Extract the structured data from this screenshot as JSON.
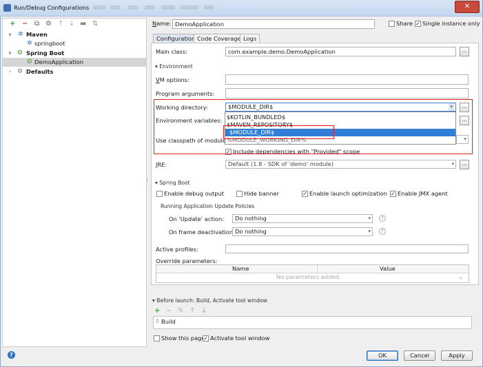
{
  "window": {
    "title": "Run/Debug Configurations"
  },
  "left_toolbar": {
    "add": "+",
    "remove": "−"
  },
  "tree": {
    "maven": "Maven",
    "springboot_item": "springboot",
    "spring_boot": "Spring Boot",
    "demo_application": "DemoApplication",
    "defaults": "Defaults"
  },
  "header": {
    "name_label": "Name:",
    "name_value": "DemoApplication",
    "share_label": "Share",
    "single_instance_label": "Single instance only"
  },
  "tabs": [
    "Configuration",
    "Code Coverage",
    "Logs"
  ],
  "config": {
    "main_class_label": "Main class:",
    "main_class_value": "com.example.demo.DemoApplication",
    "environment_header": "Environment",
    "vm_options_label": "VM options:",
    "program_args_label": "Program arguments:",
    "working_dir_label": "Working directory:",
    "working_dir_value": "$MODULE_DIR$",
    "env_vars_label": "Environment variables:",
    "classpath_label": "Use classpath of module:",
    "include_deps_label": "Include dependencies with \"Provided\" scope",
    "jre_label": "JRE:",
    "jre_value": "Default (1.8 - SDK of 'demo' module)",
    "dots": "..."
  },
  "dropdown": {
    "options": [
      "$KOTLIN_BUNDLED$",
      "$MAVEN_REPOSITORY$",
      "$MODULE_DIR$",
      "%MODULE_WORKING_DIR%"
    ]
  },
  "spring_boot": {
    "header": "Spring Boot",
    "debug_output": "Enable debug output",
    "hide_banner": "Hide banner",
    "launch_opt": "Enable launch optimization",
    "jmx_agent": "Enable JMX agent",
    "update_policies": "Running Application Update Policies",
    "on_update_label": "On 'Update' action:",
    "on_update_value": "Do nothing",
    "on_frame_label": "On frame deactivation:",
    "on_frame_value": "Do nothing",
    "active_profiles": "Active profiles:",
    "override_params": "Override parameters:",
    "col_name": "Name",
    "col_value": "Value",
    "no_params": "No parameters added."
  },
  "before_launch": {
    "header": "Before launch: Build, Activate tool window",
    "item": "Build",
    "show_page": "Show this page",
    "activate_tool": "Activate tool window"
  },
  "buttons": {
    "ok": "OK",
    "cancel": "Cancel",
    "apply": "Apply",
    "help": "?"
  }
}
